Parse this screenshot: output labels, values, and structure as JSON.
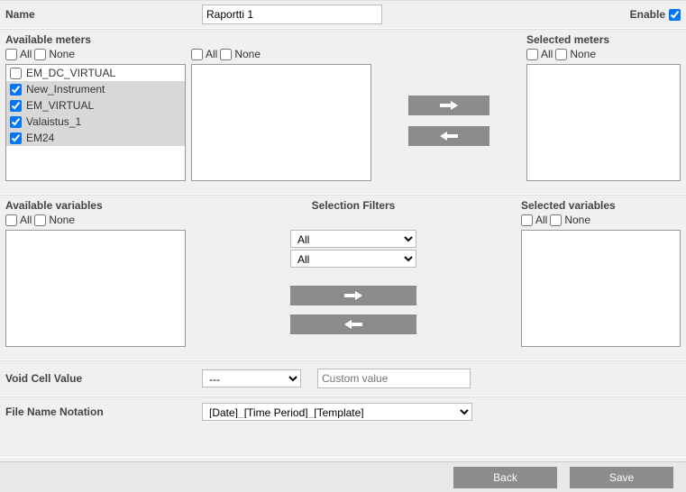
{
  "header": {
    "name_label": "Name",
    "name_value": "Raportti 1",
    "enable_label": "Enable",
    "enable_checked": true
  },
  "meters": {
    "available_label": "Available meters",
    "selected_label": "Selected meters",
    "all_label": "All",
    "none_label": "None",
    "available_items": [
      {
        "label": "EM_DC_VIRTUAL",
        "checked": false,
        "selected": false
      },
      {
        "label": "New_Instrument",
        "checked": true,
        "selected": true
      },
      {
        "label": "EM_VIRTUAL",
        "checked": true,
        "selected": true
      },
      {
        "label": "Valaistus_1",
        "checked": true,
        "selected": true
      },
      {
        "label": "EM24",
        "checked": true,
        "selected": true
      }
    ]
  },
  "variables": {
    "available_label": "Available variables",
    "selected_label": "Selected variables",
    "filters_label": "Selection Filters",
    "all_label": "All",
    "none_label": "None",
    "filter1_value": "All",
    "filter2_value": "All"
  },
  "voidcell": {
    "label": "Void Cell Value",
    "select_value": "---",
    "custom_placeholder": "Custom value"
  },
  "filename": {
    "label": "File Name Notation",
    "value": "[Date]_[Time Period]_[Template]"
  },
  "footer": {
    "back_label": "Back",
    "save_label": "Save"
  }
}
